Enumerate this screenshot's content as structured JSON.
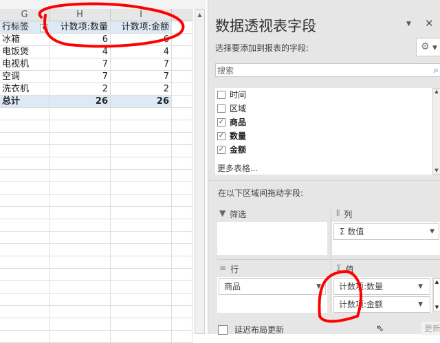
{
  "sheet": {
    "columns": [
      "G",
      "H",
      "I"
    ],
    "header": [
      "行标签",
      "计数项:数量",
      "计数项:金额"
    ],
    "rows": [
      [
        "冰箱",
        "6",
        "6"
      ],
      [
        "电饭煲",
        "4",
        "4"
      ],
      [
        "电视机",
        "7",
        "7"
      ],
      [
        "空调",
        "7",
        "7"
      ],
      [
        "洗衣机",
        "2",
        "2"
      ]
    ],
    "total": [
      "总计",
      "26",
      "26"
    ]
  },
  "panel": {
    "title": "数据透视表字段",
    "subtitle": "选择要添加到报表的字段:",
    "search_placeholder": "搜索",
    "fields": [
      {
        "label": "时间",
        "checked": false
      },
      {
        "label": "区域",
        "checked": false
      },
      {
        "label": "商品",
        "checked": true
      },
      {
        "label": "数量",
        "checked": true
      },
      {
        "label": "金额",
        "checked": true
      }
    ],
    "more_tables": "更多表格...",
    "drag_label": "在以下区域间拖动字段:",
    "filter_label": "筛选",
    "columns_label": "列",
    "columns_items": [
      "Σ 数值"
    ],
    "rows_label": "行",
    "rows_items": [
      "商品"
    ],
    "values_label": "值",
    "values_items": [
      "计数项:数量",
      "计数项:金额"
    ],
    "defer_label": "延迟布局更新",
    "update_button": "更新",
    "annotation_color": "#ff0000"
  }
}
